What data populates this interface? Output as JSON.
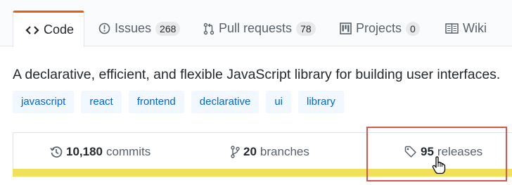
{
  "tabs": [
    {
      "label": "Code",
      "icon": "code-icon",
      "selected": true
    },
    {
      "label": "Issues",
      "icon": "issue-opened-icon",
      "count": "268"
    },
    {
      "label": "Pull requests",
      "icon": "git-pull-request-icon",
      "count": "78"
    },
    {
      "label": "Projects",
      "icon": "project-icon",
      "count": "0"
    },
    {
      "label": "Wiki",
      "icon": "book-icon"
    }
  ],
  "description": "A declarative, efficient, and flexible JavaScript library for building user interfaces.",
  "topics": [
    "javascript",
    "react",
    "frontend",
    "declarative",
    "ui",
    "library"
  ],
  "summary": {
    "commits": {
      "count": "10,180",
      "label": "commits",
      "icon": "history-icon"
    },
    "branches": {
      "count": "20",
      "label": "branches",
      "icon": "git-branch-icon"
    },
    "releases": {
      "count": "95",
      "label": "releases",
      "icon": "tag-icon"
    }
  },
  "colors": {
    "accent_tab": "#e36209",
    "language_bar": "#f1e05a",
    "highlight": "#d9534f",
    "topic_text": "#0366d6",
    "topic_bg": "#f1f8ff"
  }
}
